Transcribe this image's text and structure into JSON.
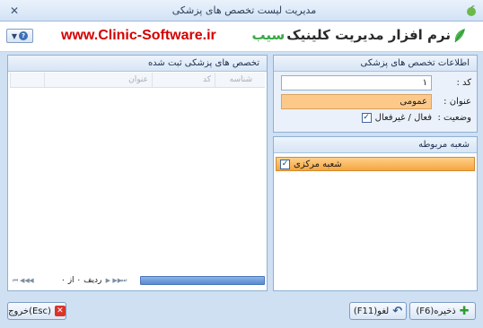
{
  "window": {
    "title": "مدیریت لیست تخصص های پزشکی"
  },
  "banner": {
    "url": "www.Clinic-Software.ir",
    "brand_main": "نرم افزار مدیریت کلینیک",
    "brand_accent": "سیب",
    "menu_icon": "chevron-down-icon",
    "help_icon": "help-icon",
    "help_glyph": "?"
  },
  "info": {
    "title": "اطلاعات تخصص های پزشکی",
    "code_label": "کد :",
    "code_value": "۱",
    "name_label": "عنوان :",
    "name_value": "عمومی",
    "status_label": "وضعیت :",
    "status_text": "فعال / غیرفعال",
    "status_checked": true
  },
  "branch": {
    "title": "شعبه مربوطه",
    "items": [
      {
        "label": "شعبه مرکزی",
        "checked": true
      }
    ]
  },
  "grid": {
    "title": "تخصص های پزشکی ثبت شده",
    "columns": [
      "شناسه",
      "کد",
      "عنوان"
    ],
    "rows": [],
    "nav_label": "ردیف ۰ از ۰"
  },
  "buttons": {
    "save": "ذخیره(F6)",
    "undo": "لغو(F11)",
    "exit": "خروج(Esc)"
  },
  "colors": {
    "accent_highlight": "#fcc98b",
    "selection_orange": "#f5a540",
    "brand_green": "#39a845",
    "url_red": "#d40000"
  }
}
